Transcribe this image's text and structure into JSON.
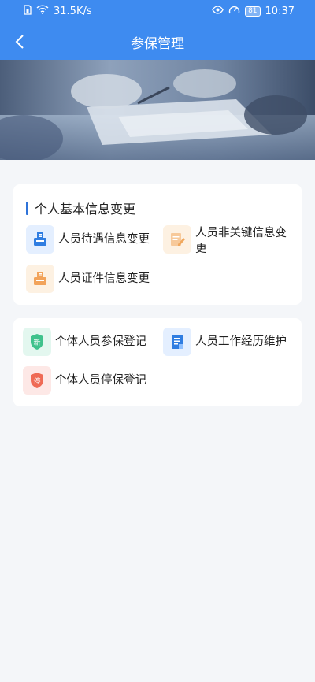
{
  "status_bar": {
    "speed": "31.5K/s",
    "battery": "81",
    "time": "10:37"
  },
  "header": {
    "title": "参保管理",
    "color": "#3e8bf0"
  },
  "section1": {
    "title": "个人基本信息变更",
    "items": [
      {
        "label": "人员待遇信息变更",
        "icon": "inbox-icon",
        "bg": "#e4efff"
      },
      {
        "label": "人员非关键信息变更",
        "icon": "document-edit-icon",
        "bg": "#fdf1e2"
      },
      {
        "label": "人员证件信息变更",
        "icon": "inbox-icon",
        "bg": "#fdf1e2"
      }
    ]
  },
  "section2": {
    "items": [
      {
        "label": "个体人员参保登记",
        "icon": "new-shield-icon",
        "badge": "新",
        "bg": "#e3f7ef"
      },
      {
        "label": "人员工作经历维护",
        "icon": "document-list-icon",
        "bg": "#e4efff"
      },
      {
        "label": "个体人员停保登记",
        "icon": "stop-shield-icon",
        "badge": "停",
        "bg": "#fde8e6"
      }
    ]
  }
}
